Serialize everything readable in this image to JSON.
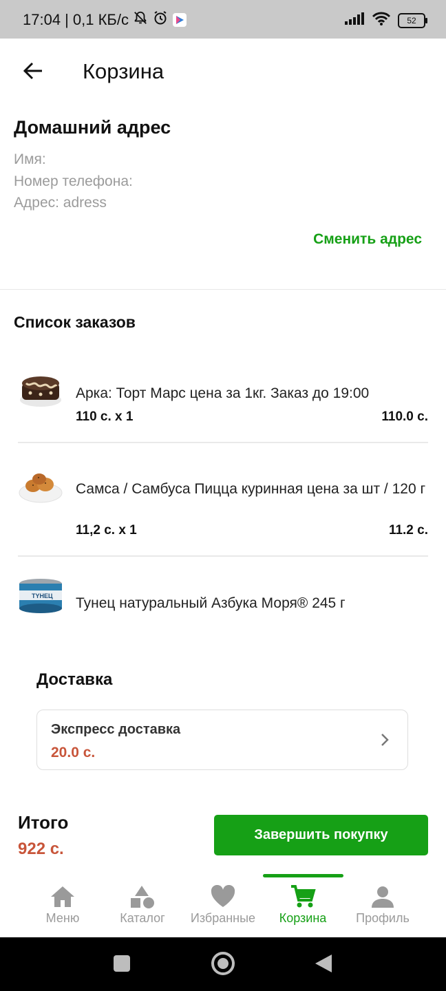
{
  "status": {
    "time": "17:04",
    "speed": "| 0,1 КБ/с",
    "battery": "52"
  },
  "header": {
    "title": "Корзина"
  },
  "address": {
    "title": "Домашний адрес",
    "name_line": "Имя:",
    "phone_line": "Номер телефона:",
    "address_line": "Адрес: adress",
    "change_label": "Сменить адрес"
  },
  "orders": {
    "title": "Список заказов",
    "items": [
      {
        "name": "Арка: Торт Марс цена за 1кг. Заказ до 19:00",
        "qty": "110 с. x 1",
        "sum": "110.0 с.",
        "image": "cake"
      },
      {
        "name": "Самса / Самбуса Пицца куринная цена за шт / 120 г",
        "qty": "11,2 с. x 1",
        "sum": "11.2 с.",
        "image": "samsa"
      },
      {
        "name": "Тунец натуральный Азбука Моря® 245 г",
        "qty": "",
        "sum": "",
        "image": "tuna-can"
      }
    ]
  },
  "delivery": {
    "title": "Доставка",
    "option_name": "Экспресс доставка",
    "option_price": "20.0 с."
  },
  "total": {
    "label": "Итого",
    "value": "922 с.",
    "button_label": "Завершить покупку"
  },
  "nav": {
    "items": [
      {
        "label": "Меню",
        "icon": "home-icon"
      },
      {
        "label": "Каталог",
        "icon": "shapes-icon"
      },
      {
        "label": "Избранные",
        "icon": "heart-icon"
      },
      {
        "label": "Корзина",
        "icon": "cart-icon"
      },
      {
        "label": "Профиль",
        "icon": "person-icon"
      }
    ],
    "active_index": 3
  },
  "colors": {
    "accent": "#16a016",
    "price": "#c8553a",
    "muted": "#9b9b9b"
  }
}
